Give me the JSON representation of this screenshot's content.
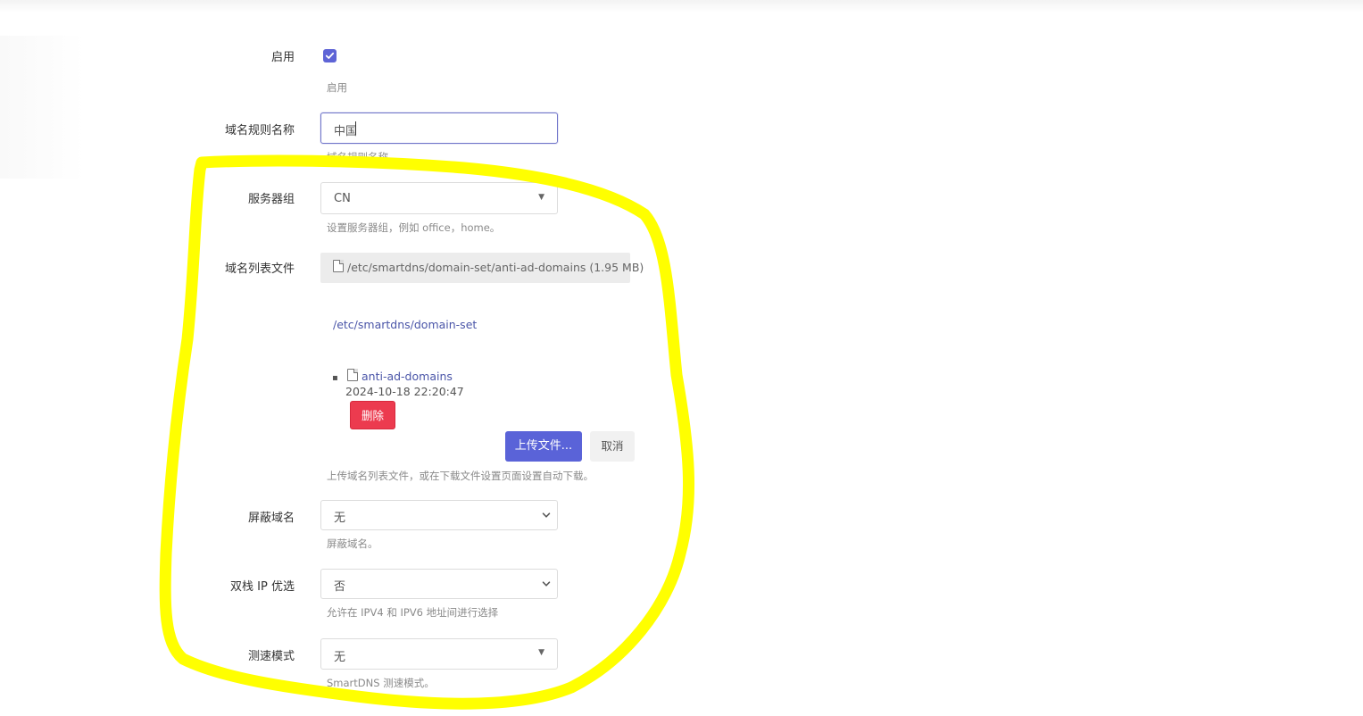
{
  "form": {
    "enable": {
      "label": "启用",
      "checked": true,
      "hint": "启用"
    },
    "rule_name": {
      "label": "域名规则名称",
      "value": "中国",
      "hint": "域名规则名称"
    },
    "server_group": {
      "label": "服务器组",
      "value": "CN",
      "hint": "设置服务器组，例如 office，home。"
    },
    "domain_list_file": {
      "label": "域名列表文件",
      "current_file": "/etc/smartdns/domain-set/anti-ad-domains (1.95 MB)",
      "directory": "/etc/smartdns/domain-set",
      "file_name": "anti-ad-domains",
      "file_date": "2024-10-18 22:20:47",
      "delete_label": "删除",
      "upload_label": "上传文件...",
      "cancel_label": "取消",
      "hint": "上传域名列表文件，或在下载文件设置页面设置自动下载。"
    },
    "block_domain": {
      "label": "屏蔽域名",
      "value": "无",
      "hint": "屏蔽域名。"
    },
    "dualstack": {
      "label": "双栈 IP 优选",
      "value": "否",
      "hint": "允许在 IPV4 和 IPV6 地址间进行选择"
    },
    "speed_mode": {
      "label": "测速模式",
      "value": "无",
      "hint": "SmartDNS 测速模式。"
    }
  },
  "colors": {
    "accent": "#5e64d6",
    "danger": "#ec3b4f",
    "annotation": "#ffff00"
  },
  "icons": {
    "check": "check-icon",
    "file": "file-icon",
    "caret": "caret-down-icon",
    "chevron": "chevron-down-icon"
  }
}
